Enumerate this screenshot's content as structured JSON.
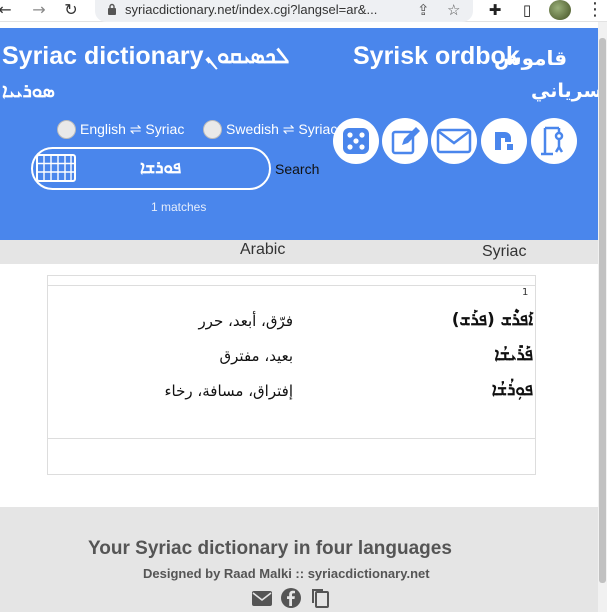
{
  "browser": {
    "url": "syriacdictionary.net/index.cgi?langsel=ar&..."
  },
  "header": {
    "title_en": "Syriac dictionary",
    "title_syr": "ܠܟܣܝܩܘܢ",
    "title_syr_line2": "ܣܘܪܝܝܐ",
    "title_sv": "Syrisk ordbok",
    "title_ar": "قاموس",
    "title_ar_line2": "سرياني",
    "radio_en": "English ⇌ Syriac",
    "radio_sv": "Swedish ⇌ Syriac",
    "search_value": "ܦܘܪܫܐ",
    "search_button": "Search",
    "matches": "1 matches",
    "accent_color": "#4a86ec"
  },
  "columns": {
    "arabic": "Arabic",
    "syriac": "Syriac"
  },
  "results": {
    "number": "1",
    "rows": [
      {
        "syriac": "ܐܰܦܪܶܫ (ܦܪܰܫ)",
        "arabic": "فرّق، أبعد، حرر"
      },
      {
        "syriac": "ܦܰܪܺܝܫܳܐ",
        "arabic": "بعيد، مفترق"
      },
      {
        "syriac": "ܦܘܼܪܳܫܳܐ",
        "arabic": "إفتراق، مسافة، رخاء"
      }
    ]
  },
  "footer": {
    "title": "Your Syriac dictionary in four languages",
    "credit": "Designed by Raad Malki :: syriacdictionary.net"
  },
  "icons": [
    "dice-icon",
    "edit-icon",
    "mail-icon",
    "letter-tile-icon",
    "hangman-icon",
    "keyboard-icon",
    "email-icon",
    "facebook-icon",
    "copy-icon"
  ]
}
